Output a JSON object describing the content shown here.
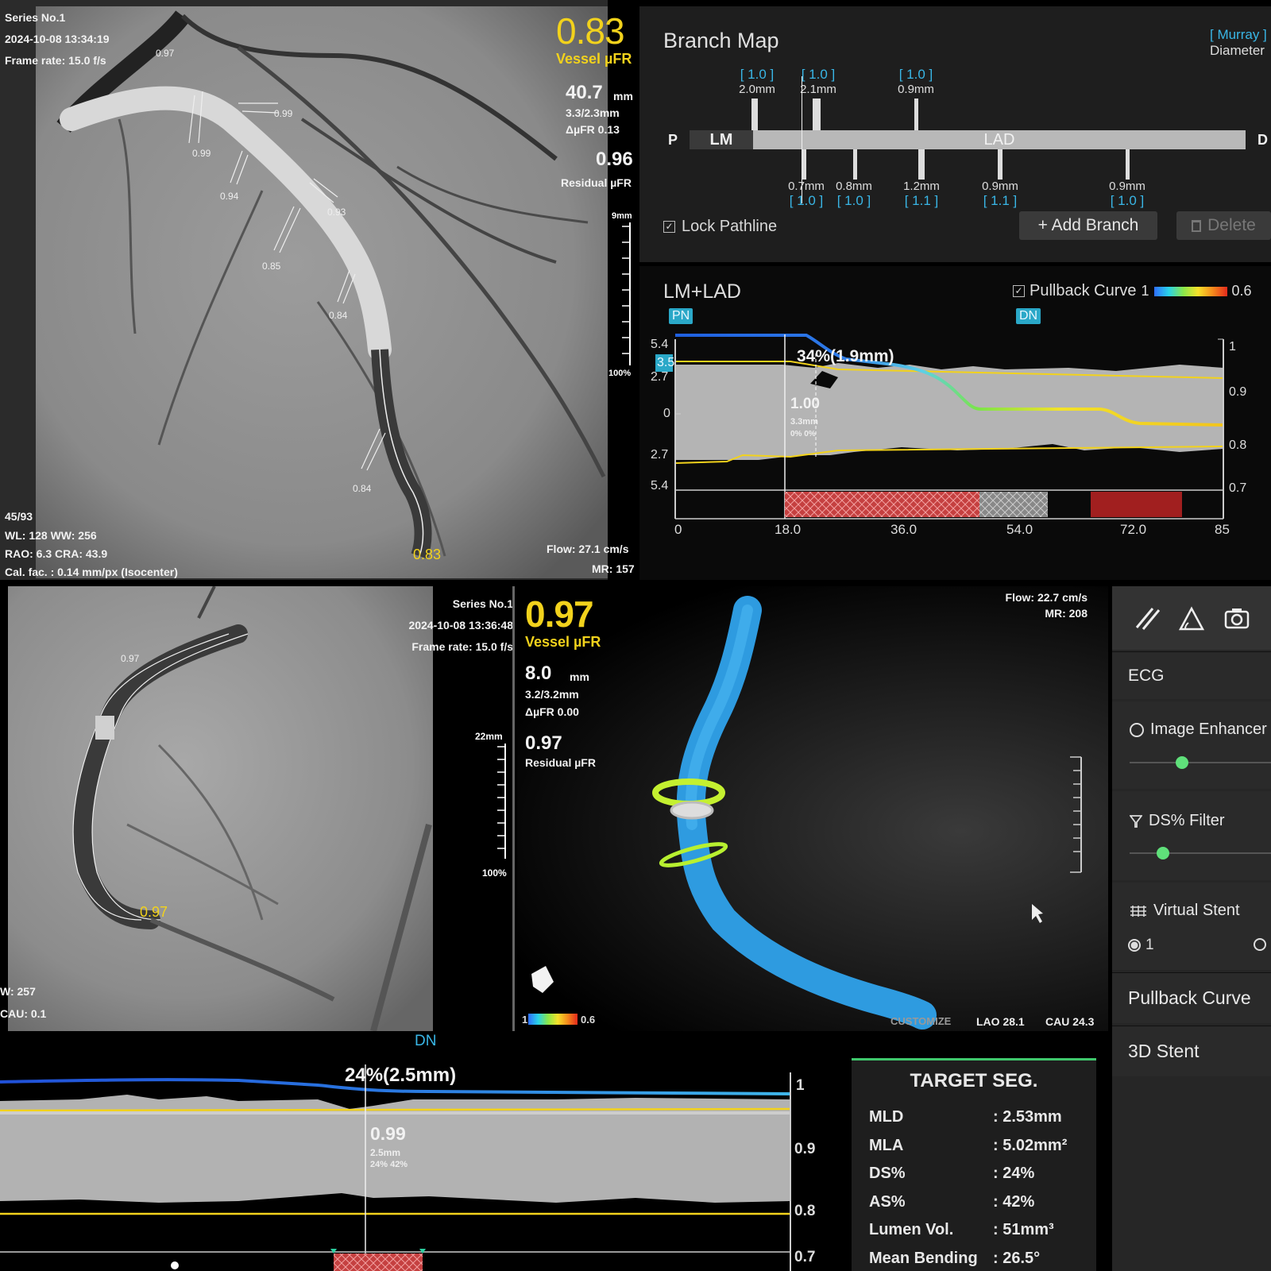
{
  "top_angio": {
    "series": "Series No.1",
    "datetime": "2024-10-08 13:34:19",
    "frame_rate": "Frame rate: 15.0 f/s",
    "vessel_ufr_value": "0.83",
    "vessel_ufr_label": "Vessel µFR",
    "length_value": "40.7",
    "length_unit": "mm",
    "diam": "3.3/2.3mm",
    "delta": "ΔµFR 0.13",
    "residual_value": "0.96",
    "residual_label": "Residual µFR",
    "scale_top": "9mm",
    "scale_bottom": "100%",
    "frame": "45/93",
    "wl_ww": "WL: 128 WW: 256",
    "rao_cra": "RAO: 6.3 CRA: 43.9",
    "cal_fac": "Cal. fac. : 0.14 mm/px (Isocenter)",
    "flow": "Flow: 27.1 cm/s",
    "mr": "MR: 157",
    "vessel_labels": [
      "0.97",
      "0.99",
      "0.99",
      "0.94",
      "0.93",
      "0.85",
      "0.84",
      "0.84",
      "0.83"
    ]
  },
  "branch_map": {
    "title": "Branch Map",
    "murray": "[ Murray ]",
    "diameter": "Diameter",
    "p_label": "P",
    "d_label": "D",
    "lm_label": "LM",
    "lad_label": "LAD",
    "top_branches": [
      {
        "ratio": "[ 1.0 ]",
        "mm": "2.0mm"
      },
      {
        "ratio": "[ 1.0 ]",
        "mm": "2.1mm"
      },
      {
        "ratio": "[ 1.0 ]",
        "mm": "0.9mm"
      }
    ],
    "bottom_branches": [
      {
        "mm": "0.7mm",
        "ratio": "[ 1.0 ]"
      },
      {
        "mm": "0.8mm",
        "ratio": "[ 1.0 ]"
      },
      {
        "mm": "1.2mm",
        "ratio": "[ 1.1 ]"
      },
      {
        "mm": "0.9mm",
        "ratio": "[ 1.1 ]"
      },
      {
        "mm": "0.9mm",
        "ratio": "[ 1.0 ]"
      }
    ],
    "lock_pathline": "Lock Pathline",
    "add_branch": "+ Add Branch",
    "delete": "Delete"
  },
  "pullback_top": {
    "title": "LM+LAD",
    "pullback_label": "Pullback Curve",
    "scale_min": "1",
    "scale_max": "0.6",
    "pn": "PN",
    "dn": "DN",
    "y_left": [
      "5.4",
      "2.7",
      "0",
      "2.7",
      "5.4"
    ],
    "ref_value": "3.5",
    "y_right": [
      "1",
      "0.9",
      "0.8",
      "0.7"
    ],
    "x_ticks": [
      "0",
      "18.0",
      "36.0",
      "54.0",
      "72.0",
      "85"
    ],
    "stenosis": "34%(1.9mm)",
    "cursor_value": "1.00",
    "cursor_mm": "3.3mm",
    "cursor_pct": "0% 0%"
  },
  "bottom_angio": {
    "series": "Series No.1",
    "datetime": "2024-10-08 13:36:48",
    "frame_rate": "Frame rate: 15.0 f/s",
    "vessel_ufr_value": "0.97",
    "vessel_ufr_label": "Vessel µFR",
    "length_value": "8.0",
    "length_unit": "mm",
    "diam": "3.2/3.2mm",
    "delta": "ΔµFR 0.00",
    "residual_value": "0.97",
    "residual_label": "Residual µFR",
    "scale_top": "22mm",
    "scale_bottom": "100%",
    "ww": "W: 257",
    "cau": "CAU: 0.1",
    "vessel_labels": [
      "0.97",
      "0.97"
    ]
  },
  "view3d": {
    "flow": "Flow: 22.7 cm/s",
    "mr": "MR: 208",
    "customize": "CUSTOMIZE",
    "lao": "LAO 28.1",
    "cau": "CAU 24.3",
    "scale_min": "1",
    "scale_max": "0.6"
  },
  "sidebar": {
    "ecg": "ECG",
    "image_enhance": "Image Enhancer",
    "ds_filter": "DS% Filter",
    "virtual_stent": "Virtual Stent",
    "radio_1": "1",
    "pullback_curve": "Pullback Curve",
    "stent_3d": "3D Stent"
  },
  "pullback_bottom": {
    "dn": "DN",
    "stenosis": "24%(2.5mm)",
    "cursor_value": "0.99",
    "cursor_mm": "2.5mm",
    "cursor_pct": "24% 42%",
    "y_right": [
      "1",
      "0.9",
      "0.8",
      "0.7"
    ]
  },
  "target_seg": {
    "title": "TARGET SEG.",
    "rows": [
      {
        "k": "MLD",
        "v": ": 2.53mm"
      },
      {
        "k": "MLA",
        "v": ": 5.02mm²"
      },
      {
        "k": "DS%",
        "v": ": 24%"
      },
      {
        "k": "AS%",
        "v": ": 42%"
      },
      {
        "k": "Lumen Vol.",
        "v": ": 51mm³"
      },
      {
        "k": "Mean Bending",
        "v": ": 26.5°"
      }
    ]
  },
  "colors": {
    "accent_yellow": "#f2d21c",
    "accent_cyan": "#39b6e6",
    "vessel_blue": "#2e9be0"
  }
}
